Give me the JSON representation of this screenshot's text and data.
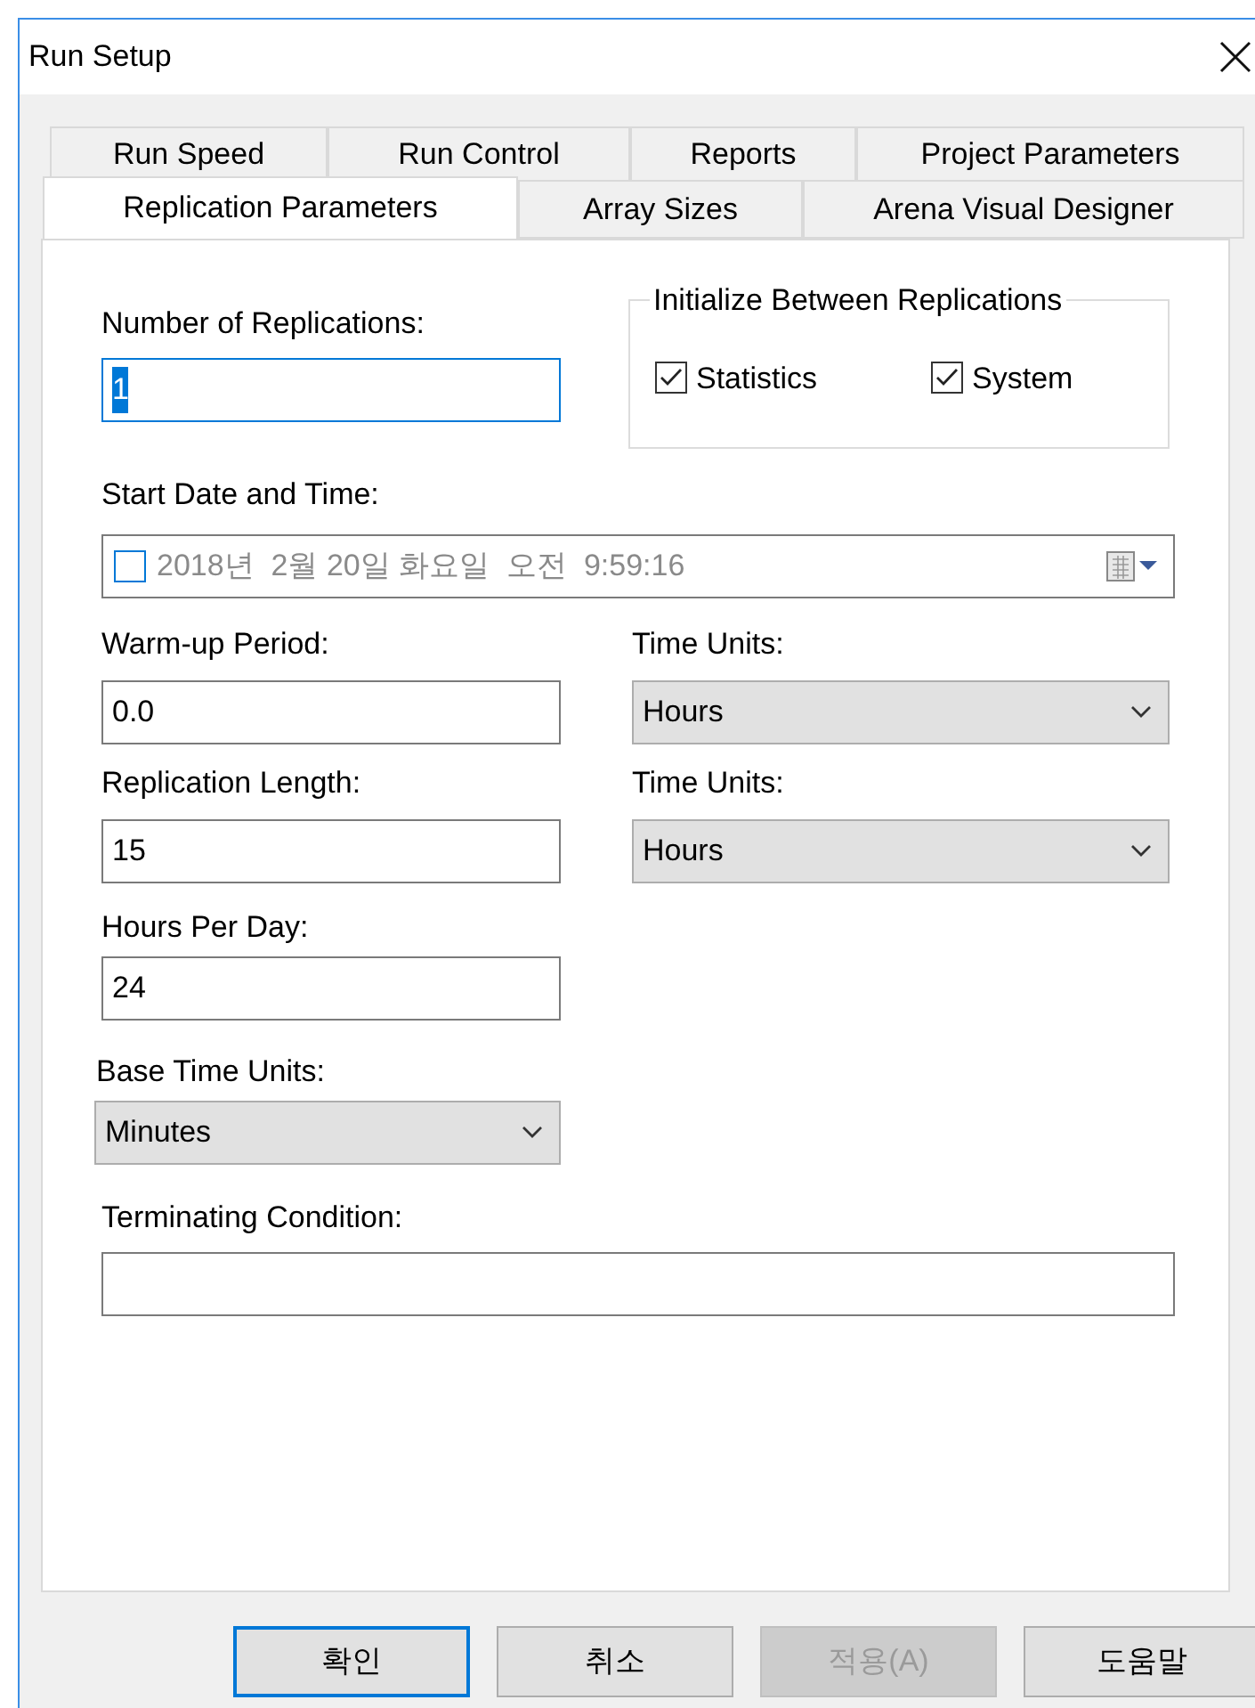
{
  "window": {
    "title": "Run Setup"
  },
  "tab_rows": [
    {
      "tabs": [
        {
          "label": "Run Speed",
          "selected": false
        },
        {
          "label": "Run Control",
          "selected": false
        },
        {
          "label": "Reports",
          "selected": false
        },
        {
          "label": "Project Parameters",
          "selected": false
        }
      ]
    },
    {
      "tabs": [
        {
          "label": "Replication Parameters",
          "selected": true
        },
        {
          "label": "Array Sizes",
          "selected": false
        },
        {
          "label": "Arena Visual Designer",
          "selected": false
        }
      ]
    }
  ],
  "number_of_replications": {
    "label": "Number of Replications:",
    "value": "1",
    "focused": true
  },
  "initialize_between_replications": {
    "title": "Initialize Between Replications",
    "options": [
      {
        "label": "Statistics",
        "checked": true
      },
      {
        "label": "System",
        "checked": true
      }
    ]
  },
  "start_date_and_time": {
    "label": "Start Date and Time:",
    "checked": false,
    "value": "2018년  2월 20일 화요일  오전  9:59:16"
  },
  "warm_up_period": {
    "label": "Warm-up Period:",
    "value": "0.0",
    "units_label": "Time Units:",
    "units": "Hours"
  },
  "replication_length": {
    "label": "Replication Length:",
    "value": "15",
    "units_label": "Time Units:",
    "units": "Hours"
  },
  "hours_per_day": {
    "label": "Hours Per Day:",
    "value": "24"
  },
  "base_time_units": {
    "label": "Base Time Units:",
    "value": "Minutes"
  },
  "terminating_condition": {
    "label": "Terminating Condition:"
  },
  "buttons": [
    {
      "label": "확인",
      "default": true,
      "disabled": false
    },
    {
      "label": "취소",
      "default": false,
      "disabled": false
    },
    {
      "label": "적용(A)",
      "default": false,
      "disabled": true
    },
    {
      "label": "도움말",
      "default": false,
      "disabled": false
    }
  ]
}
